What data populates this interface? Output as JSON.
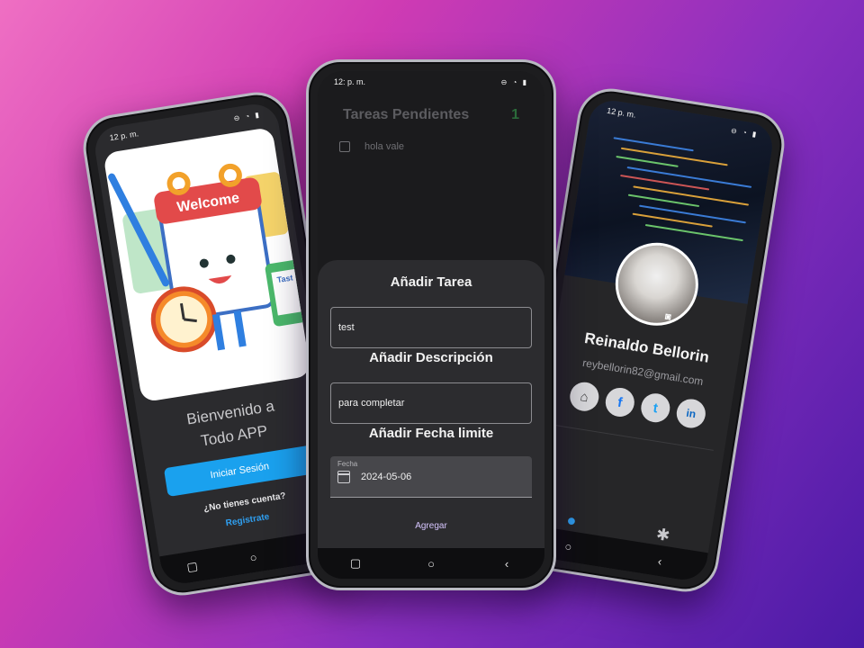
{
  "left_phone": {
    "status_time": "12",
    "status_suffix": "p. m.",
    "welcome_line1": "Bienvenido a",
    "welcome_line2": "Todo APP",
    "art_banner": "Welcome",
    "art_note": "Tast",
    "login_button": "Iniciar Sesión",
    "no_account": "¿No tienes cuenta?",
    "register_link": "Registrate"
  },
  "center_phone": {
    "status_time": "12:",
    "status_suffix": "p. m.",
    "header_title": "Tareas Pendientes",
    "pending_count": "1",
    "task_label": "hola vale",
    "sheet": {
      "title": "Añadir Tarea",
      "task_value": "test",
      "description_title": "Añadir Descripción",
      "description_value": "para completar",
      "date_title": "Añadir Fecha limite",
      "date_label": "Fecha",
      "date_value": "2024-05-06",
      "add_button": "Agregar"
    }
  },
  "right_phone": {
    "status_time": "12",
    "status_suffix": "p. m.",
    "name": "Reinaldo Bellorin",
    "email": "reybellorin82@gmail.com",
    "socials": [
      "github",
      "facebook",
      "twitter",
      "linkedin"
    ],
    "social_glyphs": [
      "⌂",
      "f",
      "t",
      "in"
    ]
  },
  "colors": {
    "accent_blue": "#1aa1ee",
    "link_blue": "#2f9ff0",
    "button_purple": "#d7c6ff",
    "count_green": "#2b6b3a"
  }
}
